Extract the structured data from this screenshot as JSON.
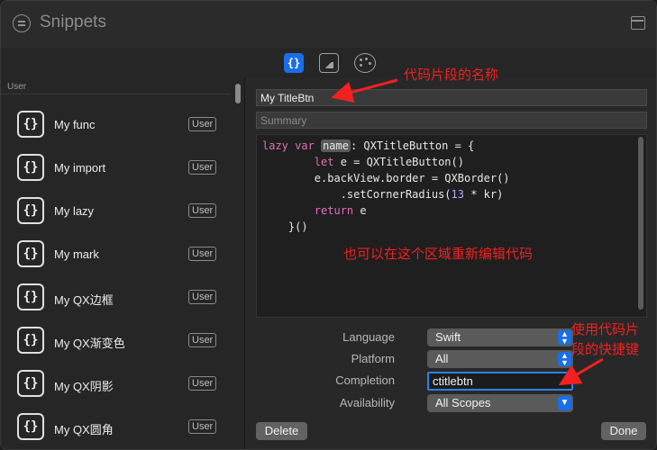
{
  "window": {
    "title": "Snippets"
  },
  "toolbar": {
    "code_tab": "{}"
  },
  "sidebar": {
    "section": "User",
    "items": [
      {
        "icon": "{}",
        "label": "My func",
        "badge": "User"
      },
      {
        "icon": "{}",
        "label": "My import",
        "badge": "User"
      },
      {
        "icon": "{}",
        "label": "My lazy",
        "badge": "User"
      },
      {
        "icon": "{}",
        "label": "My mark",
        "badge": "User"
      },
      {
        "icon": "{}",
        "label": "My QX边框",
        "badge": "User"
      },
      {
        "icon": "{}",
        "label": "My QX渐变色",
        "badge": "User"
      },
      {
        "icon": "{}",
        "label": "My QX阴影",
        "badge": "User"
      },
      {
        "icon": "{}",
        "label": "My QX圆角",
        "badge": "User"
      }
    ]
  },
  "detail": {
    "name": "My TitleBtn",
    "summary_placeholder": "Summary",
    "code": {
      "l1_kw1": "lazy",
      "l1_kw2": "var",
      "l1_ph": "name",
      "l1_rest": ": QXTitleButton = {",
      "l2_kw": "let",
      "l2_rest": " e = QXTitleButton()",
      "l3": "e.backView.border = QXBorder()",
      "l4_pre": ".setCornerRadius(",
      "l4_num": "13",
      "l4_post": " * kr)",
      "l5_kw": "return",
      "l5_rest": " e",
      "l6": "}()"
    },
    "language": {
      "label": "Language",
      "value": "Swift"
    },
    "platform": {
      "label": "Platform",
      "value": "All"
    },
    "completion": {
      "label": "Completion",
      "value": "ctitlebtn"
    },
    "availability": {
      "label": "Availability",
      "value": "All Scopes"
    },
    "delete_label": "Delete",
    "done_label": "Done"
  },
  "annotations": {
    "name_note": "代码片段的名称",
    "code_note": "也可以在这个区域重新编辑代码",
    "shortcut_note_1": "使用代码片",
    "shortcut_note_2": "段的快捷键"
  },
  "colors": {
    "accent": "#1a6ee8",
    "annotation": "#f22020",
    "keyword": "#e26fb8",
    "number": "#b8a3ff"
  },
  "icons": [
    "snippets-icon",
    "sidebar-toggle-icon",
    "code-braces-icon",
    "image-icon",
    "palette-icon",
    "chevron-updown-icon",
    "chevron-down-icon"
  ]
}
